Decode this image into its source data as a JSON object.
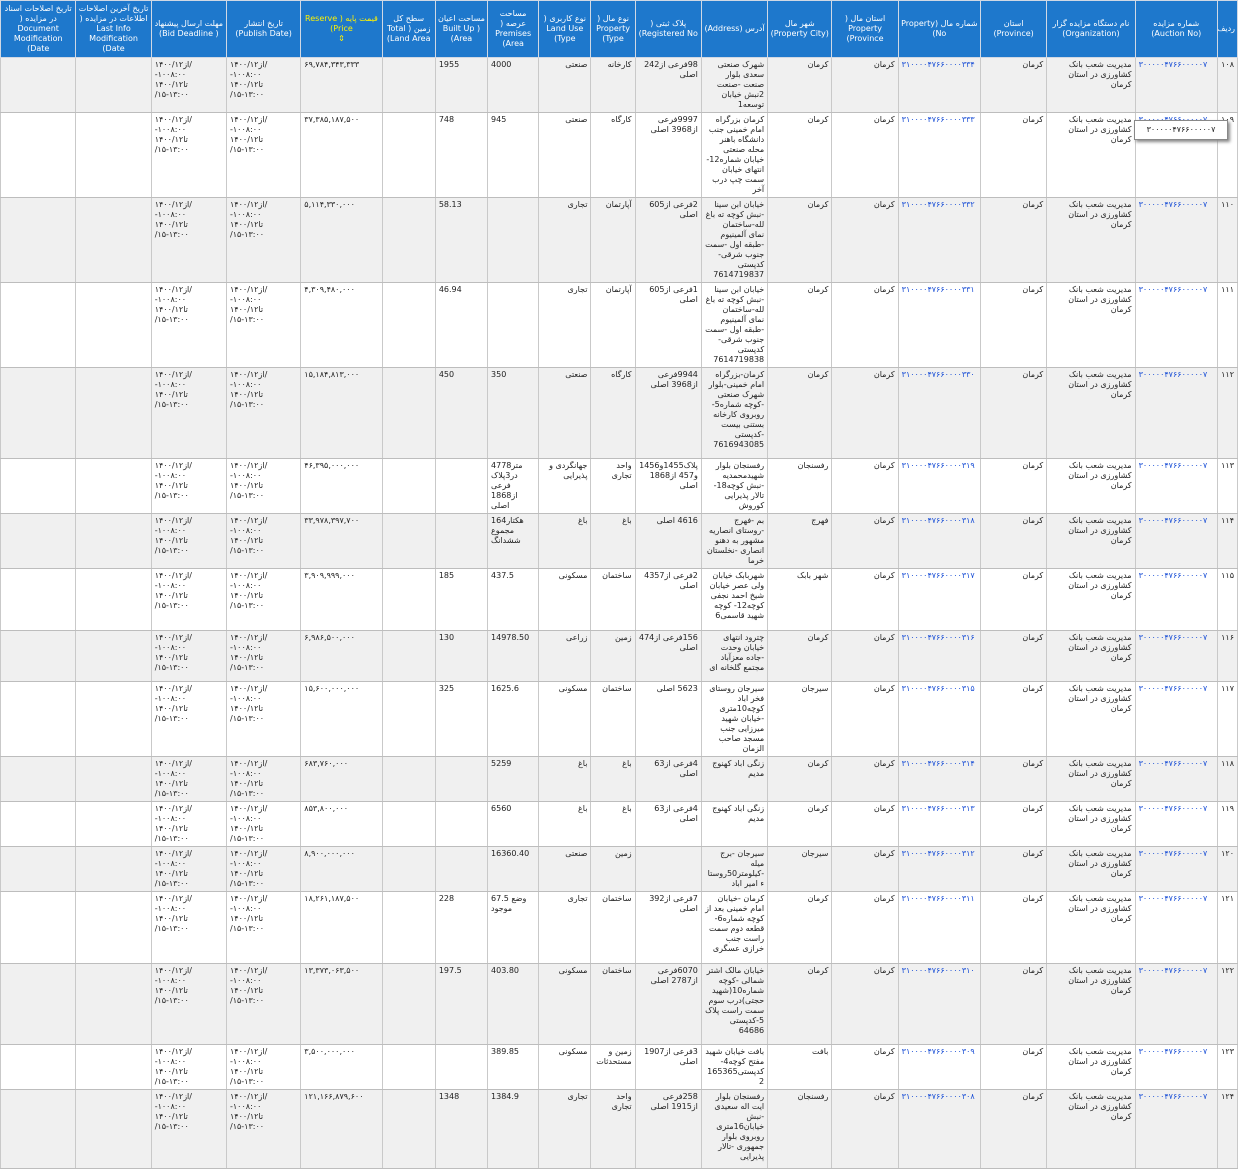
{
  "columns": [
    {
      "key": "row",
      "label": "ردیف",
      "w": 20
    },
    {
      "key": "auction",
      "label": "شماره مزایده (Auction No)",
      "w": 82
    },
    {
      "key": "org",
      "label": "نام دستگاه مزایده گزار (Organization)",
      "w": 88
    },
    {
      "key": "province",
      "label": "استان (Province)",
      "w": 66
    },
    {
      "key": "propno",
      "label": "شماره مال (Property No)",
      "w": 82
    },
    {
      "key": "propprov",
      "label": "استان مال ( Property Province)",
      "w": 66
    },
    {
      "key": "city",
      "label": "شهر مال (Property City)",
      "w": 64
    },
    {
      "key": "address",
      "label": "آدرس (Address)",
      "w": 66
    },
    {
      "key": "reg",
      "label": "پلاک ثبتی ( Registered No)",
      "w": 66
    },
    {
      "key": "type",
      "label": "نوع مال ( Property Type)",
      "w": 44
    },
    {
      "key": "use",
      "label": "نوع کاربری ( Land Use Type)",
      "w": 52
    },
    {
      "key": "area",
      "label": "مساحت عرصه ( Premises Area)",
      "w": 51
    },
    {
      "key": "built",
      "label": "مساحت اعیان ( Built Up Area)",
      "w": 52
    },
    {
      "key": "land",
      "label": "سطح کل زمین ( Total Land Area)",
      "w": 53
    },
    {
      "key": "price",
      "label": "قیمت پایه ( Reserve Price)",
      "w": 81,
      "accent": true
    },
    {
      "key": "publish",
      "label": "تاریخ انتشار (Publish Date)",
      "w": 74
    },
    {
      "key": "deadline",
      "label": "مهلت ارسال پیشنهاد ( Bid Deadline)",
      "w": 75
    },
    {
      "key": "lastmod",
      "label": "تاریخ آخرین اصلاحات اطلاعات در مزایده ( Last Info Modification Date)",
      "w": 75
    },
    {
      "key": "docmod",
      "label": "تاریخ اصلاحات اسناد در مزایده ( Document Modification Date)",
      "w": 75
    }
  ],
  "sort_arrow": "⇕",
  "tooltip_text": "۳۰۰۰۰۰۴۷۶۶۰۰۰۰۰۷",
  "colors": {
    "header_bg": "#1e78cc",
    "header_text": "#ffffff",
    "price_header": "#fff200",
    "link": "#1a4fd6",
    "odd_row": "#f0f0f0"
  },
  "rows": [
    {
      "h": 50,
      "row": "۱۰۸",
      "auction": "۳۰۰۰۰۰۴۷۶۶۰۰۰۰۰۷",
      "org": "مدیریت شعب بانک کشاورزی در استان کرمان",
      "province": "کرمان",
      "propno": "۳۱۰۰۰۰۴۷۶۶۰۰۰۰۳۳۴",
      "propprov": "کرمان",
      "city": "کرمان",
      "address": "شهرک صنعتی سعدی بلوار صنعت -صنعت 2نبش خیابان توسعه1",
      "reg": "98فرعی از242 اصلی",
      "type": "کارخانه",
      "use": "صنعتی",
      "area": "4000",
      "built": "1955",
      "land": "",
      "price": "۶۹,۷۸۴,۳۴۳,۳۳۳",
      "publish": "از۱۴۰۰/۱۲/\n-۱۰۰۸:۰۰\n۱۴۰۰/۱۲تا\n/۱۵-۱۳:۰۰",
      "deadline": "از۱۴۰۰/۱۲/\n-۱۰۰۸:۰۰\n۱۴۰۰/۱۲تا\n/۱۵-۱۳:۰۰",
      "lastmod": "",
      "docmod": ""
    },
    {
      "h": 81,
      "row": "۱۰۹",
      "auction": "۳۰۰۰۰۰۴۷۶۶۰۰۰۰۰۷",
      "org": "مدیریت شعب بانک کشاورزی در استان کرمان",
      "province": "کرمان",
      "propno": "۳۱۰۰۰۰۴۷۶۶۰۰۰۰۳۳۳",
      "propprov": "کرمان",
      "city": "کرمان",
      "address": "کرمان بزرگراه امام خمینی جنب دانشگاه باهنر محله صنعتی خیابان شماره12-انتهای خیابان سمت چپ درب آخر",
      "reg": "9997فرعی از3968 اصلی",
      "type": "کارگاه",
      "use": "صنعتی",
      "area": "945",
      "built": "748",
      "land": "",
      "price": "۳۷,۳۸۵,۱۸۷,۵۰۰",
      "publish": "از۱۴۰۰/۱۲/\n-۱۰۰۸:۰۰\n۱۴۰۰/۱۲تا\n/۱۵-۱۳:۰۰",
      "deadline": "از۱۴۰۰/۱۲/\n-۱۰۰۸:۰۰\n۱۴۰۰/۱۲تا\n/۱۵-۱۳:۰۰",
      "lastmod": "",
      "docmod": ""
    },
    {
      "h": 82,
      "row": "۱۱۰",
      "auction": "۳۰۰۰۰۰۴۷۶۶۰۰۰۰۰۷",
      "org": "مدیریت شعب بانک کشاورزی در استان کرمان",
      "province": "کرمان",
      "propno": "۳۱۰۰۰۰۴۷۶۶۰۰۰۰۳۳۲",
      "propprov": "کرمان",
      "city": "کرمان",
      "address": "خیابان ابن سینا -نبش کوچه ته باغ لله-ساختمان نمای آلمینیوم -طبقه اول -سمت جنوب شرقی-کدپستی 7614719837",
      "reg": "2فرعی از605 اصلی",
      "type": "آپارتمان",
      "use": "تجاری",
      "area": "",
      "built": "58.13",
      "land": "",
      "price": "۵,۱۱۴,۳۳۰,۰۰۰",
      "publish": "از۱۴۰۰/۱۲/\n-۱۰۰۸:۰۰\n۱۴۰۰/۱۲تا\n/۱۵-۱۳:۰۰",
      "deadline": "از۱۴۰۰/۱۲/\n-۱۰۰۸:۰۰\n۱۴۰۰/۱۲تا\n/۱۵-۱۳:۰۰",
      "lastmod": "",
      "docmod": ""
    },
    {
      "h": 81,
      "row": "۱۱۱",
      "auction": "۳۰۰۰۰۰۴۷۶۶۰۰۰۰۰۷",
      "org": "مدیریت شعب بانک کشاورزی در استان کرمان",
      "province": "کرمان",
      "propno": "۳۱۰۰۰۰۴۷۶۶۰۰۰۰۳۳۱",
      "propprov": "کرمان",
      "city": "کرمان",
      "address": "خیابان ابن سینا -نبش کوچه ته باغ لله-ساختمان نمای آلمینیوم -طبقه اول -سمت جنوب شرقی-کدپستی 7614719838",
      "reg": "1فرعی از605 اصلی",
      "type": "آپارتمان",
      "use": "تجاری",
      "area": "",
      "built": "46.94",
      "land": "",
      "price": "۴,۳۰۹,۴۸۰,۰۰۰",
      "publish": "از۱۴۰۰/۱۲/\n-۱۰۰۸:۰۰\n۱۴۰۰/۱۲تا\n/۱۵-۱۳:۰۰",
      "deadline": "از۱۴۰۰/۱۲/\n-۱۰۰۸:۰۰\n۱۴۰۰/۱۲تا\n/۱۵-۱۳:۰۰",
      "lastmod": "",
      "docmod": ""
    },
    {
      "h": 91,
      "row": "۱۱۲",
      "auction": "۳۰۰۰۰۰۴۷۶۶۰۰۰۰۰۷",
      "org": "مدیریت شعب بانک کشاورزی در استان کرمان",
      "province": "کرمان",
      "propno": "۳۱۰۰۰۰۴۷۶۶۰۰۰۰۳۳۰",
      "propprov": "کرمان",
      "city": "کرمان",
      "address": "کرمان-بزرگراه امام خمینی-بلوار شهرک صنعتی -کوچه شماره5-روبروی کارخانه بستنی بیست -کدپستی 7616943085",
      "reg": "9944فرعی از3968 اصلی",
      "type": "کارگاه",
      "use": "صنعتی",
      "area": "350",
      "built": "450",
      "land": "",
      "price": "۱۵,۱۸۴,۸۱۳,۰۰۰",
      "publish": "از۱۴۰۰/۱۲/\n-۱۰۰۸:۰۰\n۱۴۰۰/۱۲تا\n/۱۵-۱۳:۰۰",
      "deadline": "از۱۴۰۰/۱۲/\n-۱۰۰۸:۰۰\n۱۴۰۰/۱۲تا\n/۱۵-۱۳:۰۰",
      "lastmod": "",
      "docmod": ""
    },
    {
      "h": 51,
      "row": "۱۱۳",
      "auction": "۳۰۰۰۰۰۴۷۶۶۰۰۰۰۰۷",
      "org": "مدیریت شعب بانک کشاورزی در استان کرمان",
      "province": "کرمان",
      "propno": "۳۱۰۰۰۰۴۷۶۶۰۰۰۰۳۱۹",
      "propprov": "کرمان",
      "city": "رفسنجان",
      "address": "رفسنجان بلوار شهیدمحمدیه -نبش کوچه18- تالار پذیرایی کوروش",
      "reg": "پلاک1455و1456و457 از1868 اصلی",
      "type": "واحد تجاری",
      "use": "جهانگردی و پذیرایی",
      "area": "4778متر در3پلاک فرعی از1868 اصلی",
      "built": "",
      "land": "",
      "price": "۴۶,۳۹۵,۰۰۰,۰۰۰",
      "publish": "از۱۴۰۰/۱۲/\n-۱۰۰۸:۰۰\n۱۴۰۰/۱۲تا\n/۱۵-۱۳:۰۰",
      "deadline": "از۱۴۰۰/۱۲/\n-۱۰۰۸:۰۰\n۱۴۰۰/۱۲تا\n/۱۵-۱۳:۰۰",
      "lastmod": "",
      "docmod": ""
    },
    {
      "h": 51,
      "row": "۱۱۴",
      "auction": "۳۰۰۰۰۰۴۷۶۶۰۰۰۰۰۷",
      "org": "مدیریت شعب بانک کشاورزی در استان کرمان",
      "province": "کرمان",
      "propno": "۳۱۰۰۰۰۴۷۶۶۰۰۰۰۳۱۸",
      "propprov": "کرمان",
      "city": "فهرج",
      "address": "بم -فهرج -روستای انصاریه مشهور به دهنو انصاری -نخلستان خرما",
      "reg": "4616 اصلی",
      "type": "باغ",
      "use": "باغ",
      "area": "164هکتار مجموع ششدانگ",
      "built": "",
      "land": "",
      "price": "۳۳,۹۷۸,۳۹۷,۷۰۰",
      "publish": "از۱۴۰۰/۱۲/\n-۱۰۰۸:۰۰\n۱۴۰۰/۱۲تا\n/۱۵-۱۳:۰۰",
      "deadline": "از۱۴۰۰/۱۲/\n-۱۰۰۸:۰۰\n۱۴۰۰/۱۲تا\n/۱۵-۱۳:۰۰",
      "lastmod": "",
      "docmod": ""
    },
    {
      "h": 62,
      "row": "۱۱۵",
      "auction": "۳۰۰۰۰۰۴۷۶۶۰۰۰۰۰۷",
      "org": "مدیریت شعب بانک کشاورزی در استان کرمان",
      "province": "کرمان",
      "propno": "۳۱۰۰۰۰۴۷۶۶۰۰۰۰۳۱۷",
      "propprov": "کرمان",
      "city": "شهر بابک",
      "address": "شهربابک خیابان ولی عصر خیابان شیخ احمد نجفی کوچه12- کوچه شهید قاسمی6",
      "reg": "2فرعی از4357 اصلی",
      "type": "ساختمان",
      "use": "مسکونی",
      "area": "437.5",
      "built": "185",
      "land": "",
      "price": "۳,۹۰۹,۹۹۹,۰۰۰",
      "publish": "از۱۴۰۰/۱۲/\n-۱۰۰۸:۰۰\n۱۴۰۰/۱۲تا\n/۱۵-۱۳:۰۰",
      "deadline": "از۱۴۰۰/۱۲/\n-۱۰۰۸:۰۰\n۱۴۰۰/۱۲تا\n/۱۵-۱۳:۰۰",
      "lastmod": "",
      "docmod": ""
    },
    {
      "h": 51,
      "row": "۱۱۶",
      "auction": "۳۰۰۰۰۰۴۷۶۶۰۰۰۰۰۷",
      "org": "مدیریت شعب بانک کشاورزی در استان کرمان",
      "province": "کرمان",
      "propno": "۳۱۰۰۰۰۴۷۶۶۰۰۰۰۳۱۶",
      "propprov": "کرمان",
      "city": "کرمان",
      "address": "چترود انتهای خیابان وحدت -جاده معزآباد مجتمع گلخانه ای",
      "reg": "156فرعی از474 اصلی",
      "type": "زمین",
      "use": "زراعی",
      "area": "14978.50",
      "built": "130",
      "land": "",
      "price": "۶,۹۸۶,۵۰۰,۰۰۰",
      "publish": "از۱۴۰۰/۱۲/\n-۱۰۰۸:۰۰\n۱۴۰۰/۱۲تا\n/۱۵-۱۳:۰۰",
      "deadline": "از۱۴۰۰/۱۲/\n-۱۰۰۸:۰۰\n۱۴۰۰/۱۲تا\n/۱۵-۱۳:۰۰",
      "lastmod": "",
      "docmod": ""
    },
    {
      "h": 72,
      "row": "۱۱۷",
      "auction": "۳۰۰۰۰۰۴۷۶۶۰۰۰۰۰۷",
      "org": "مدیریت شعب بانک کشاورزی در استان کرمان",
      "province": "کرمان",
      "propno": "۳۱۰۰۰۰۴۷۶۶۰۰۰۰۳۱۵",
      "propprov": "کرمان",
      "city": "سیرجان",
      "address": "سیرجان روستای فخر اباد کوچه10متری -خیابان شهید میرزایی جنب مسجد صاحب الزمان",
      "reg": "5623 اصلی",
      "type": "ساختمان",
      "use": "مسکونی",
      "area": "1625.6",
      "built": "325",
      "land": "",
      "price": "۱۵,۶۰۰,۰۰۰,۰۰۰",
      "publish": "از۱۴۰۰/۱۲/\n-۱۰۰۸:۰۰\n۱۴۰۰/۱۲تا\n/۱۵-۱۳:۰۰",
      "deadline": "از۱۴۰۰/۱۲/\n-۱۰۰۸:۰۰\n۱۴۰۰/۱۲تا\n/۱۵-۱۳:۰۰",
      "lastmod": "",
      "docmod": ""
    },
    {
      "h": 41,
      "row": "۱۱۸",
      "auction": "۳۰۰۰۰۰۴۷۶۶۰۰۰۰۰۷",
      "org": "مدیریت شعب بانک کشاورزی در استان کرمان",
      "province": "کرمان",
      "propno": "۳۱۰۰۰۰۴۷۶۶۰۰۰۰۳۱۴",
      "propprov": "کرمان",
      "city": "کرمان",
      "address": "زنگی اباد کهنوج مدیم",
      "reg": "4فرعی از63 اصلی",
      "type": "باغ",
      "use": "باغ",
      "area": "5259",
      "built": "",
      "land": "",
      "price": "۶۸۳,۷۶۰,۰۰۰",
      "publish": "از۱۴۰۰/۱۲/\n-۱۰۰۸:۰۰\n۱۴۰۰/۱۲تا\n/۱۵-۱۳:۰۰",
      "deadline": "از۱۴۰۰/۱۲/\n-۱۰۰۸:۰۰\n۱۴۰۰/۱۲تا\n/۱۵-۱۳:۰۰",
      "lastmod": "",
      "docmod": ""
    },
    {
      "h": 41,
      "row": "۱۱۹",
      "auction": "۳۰۰۰۰۰۴۷۶۶۰۰۰۰۰۷",
      "org": "مدیریت شعب بانک کشاورزی در استان کرمان",
      "province": "کرمان",
      "propno": "۳۱۰۰۰۰۴۷۶۶۰۰۰۰۳۱۳",
      "propprov": "کرمان",
      "city": "کرمان",
      "address": "زنگی اباد کهنوج مدیم",
      "reg": "4فرعی از63 اصلی",
      "type": "باغ",
      "use": "باغ",
      "area": "6560",
      "built": "",
      "land": "",
      "price": "۸۵۳,۸۰۰,۰۰۰",
      "publish": "از۱۴۰۰/۱۲/\n-۱۰۰۸:۰۰\n۱۴۰۰/۱۲تا\n/۱۵-۱۳:۰۰",
      "deadline": "از۱۴۰۰/۱۲/\n-۱۰۰۸:۰۰\n۱۴۰۰/۱۲تا\n/۱۵-۱۳:۰۰",
      "lastmod": "",
      "docmod": ""
    },
    {
      "h": 41,
      "row": "۱۲۰",
      "auction": "۳۰۰۰۰۰۴۷۶۶۰۰۰۰۰۷",
      "org": "مدیریت شعب بانک کشاورزی در استان کرمان",
      "province": "کرمان",
      "propno": "۳۱۰۰۰۰۴۷۶۶۰۰۰۰۳۱۲",
      "propprov": "کرمان",
      "city": "سیرجان",
      "address": "سیرجان -برج میله -کیلومتر50روستاء امیر اباد",
      "reg": "",
      "type": "زمین",
      "use": "صنعتی",
      "area": "16360.40",
      "built": "",
      "land": "",
      "price": "۸,۹۰۰,۰۰۰,۰۰۰",
      "publish": "از۱۴۰۰/۱۲/\n-۱۰۰۸:۰۰\n۱۴۰۰/۱۲تا\n/۱۵-۱۳:۰۰",
      "deadline": "از۱۴۰۰/۱۲/\n-۱۰۰۸:۰۰\n۱۴۰۰/۱۲تا\n/۱۵-۱۳:۰۰",
      "lastmod": "",
      "docmod": ""
    },
    {
      "h": 72,
      "row": "۱۲۱",
      "auction": "۳۰۰۰۰۰۴۷۶۶۰۰۰۰۰۷",
      "org": "مدیریت شعب بانک کشاورزی در استان کرمان",
      "province": "کرمان",
      "propno": "۳۱۰۰۰۰۴۷۶۶۰۰۰۰۳۱۱",
      "propprov": "کرمان",
      "city": "کرمان",
      "address": "کرمان -خیابان امام خمینی بعد از کوچه شماره6-قطعه دوم سمت راست جنب خرازی عسگری",
      "reg": "7فرعی از392 اصلی",
      "type": "ساختمان",
      "use": "تجاری",
      "area": "67.5 وضع موجود",
      "built": "228",
      "land": "",
      "price": "۱۸,۲۶۱,۱۸۷,۵۰۰",
      "publish": "از۱۴۰۰/۱۲/\n-۱۰۰۸:۰۰\n۱۴۰۰/۱۲تا\n/۱۵-۱۳:۰۰",
      "deadline": "از۱۴۰۰/۱۲/\n-۱۰۰۸:۰۰\n۱۴۰۰/۱۲تا\n/۱۵-۱۳:۰۰",
      "lastmod": "",
      "docmod": ""
    },
    {
      "h": 81,
      "row": "۱۲۲",
      "auction": "۳۰۰۰۰۰۴۷۶۶۰۰۰۰۰۷",
      "org": "مدیریت شعب بانک کشاورزی در استان کرمان",
      "province": "کرمان",
      "propno": "۳۱۰۰۰۰۴۷۶۶۰۰۰۰۳۱۰",
      "propprov": "کرمان",
      "city": "کرمان",
      "address": "خیابان مالک اشتر شمالی -کوچه شماره10(شهید حجتی)درب سوم سمت راست پلاک 5-کدپستی 64686",
      "reg": "6070فرعی از2787 اصلی",
      "type": "ساختمان",
      "use": "مسکونی",
      "area": "403.80",
      "built": "197.5",
      "land": "",
      "price": "۱۳,۳۷۳,۰۶۳,۵۰۰",
      "publish": "از۱۴۰۰/۱۲/\n-۱۰۰۸:۰۰\n۱۴۰۰/۱۲تا\n/۱۵-۱۳:۰۰",
      "deadline": "از۱۴۰۰/۱۲/\n-۱۰۰۸:۰۰\n۱۴۰۰/۱۲تا\n/۱۵-۱۳:۰۰",
      "lastmod": "",
      "docmod": ""
    },
    {
      "h": 41,
      "row": "۱۲۳",
      "auction": "۳۰۰۰۰۰۴۷۶۶۰۰۰۰۰۷",
      "org": "مدیریت شعب بانک کشاورزی در استان کرمان",
      "province": "کرمان",
      "propno": "۳۱۰۰۰۰۴۷۶۶۰۰۰۰۳۰۹",
      "propprov": "کرمان",
      "city": "بافت",
      "address": "بافت خیابان شهید مفتح کوچه4- کدپستی1653652",
      "reg": "3فرعی از1907 اصلی",
      "type": "زمین و مستحدثات",
      "use": "مسکونی",
      "area": "389.85",
      "built": "",
      "land": "",
      "price": "۳,۵۰۰,۰۰۰,۰۰۰",
      "publish": "از۱۴۰۰/۱۲/\n-۱۰۰۸:۰۰\n۱۴۰۰/۱۲تا\n/۱۵-۱۳:۰۰",
      "deadline": "از۱۴۰۰/۱۲/\n-۱۰۰۸:۰۰\n۱۴۰۰/۱۲تا\n/۱۵-۱۳:۰۰",
      "lastmod": "",
      "docmod": ""
    },
    {
      "h": 79,
      "row": "۱۲۴",
      "auction": "۳۰۰۰۰۰۴۷۶۶۰۰۰۰۰۷",
      "org": "مدیریت شعب بانک کشاورزی در استان کرمان",
      "province": "کرمان",
      "propno": "۳۱۰۰۰۰۴۷۶۶۰۰۰۰۳۰۸",
      "propprov": "کرمان",
      "city": "رفسنجان",
      "address": "رفسنجان بلوار ایت اله سعیدی -نبش خیابان16متری روبروی بلوار جمهوری -تالار پذیرایی",
      "reg": "258فرعی از1915 اصلی",
      "type": "واحد تجاری",
      "use": "تجاری",
      "area": "1384.9",
      "built": "1348",
      "land": "",
      "price": "۱۲۱,۱۶۶,۸۷۹,۶۰۰",
      "publish": "از۱۴۰۰/۱۲/\n-۱۰۰۸:۰۰\n۱۴۰۰/۱۲تا\n/۱۵-۱۳:۰۰",
      "deadline": "از۱۴۰۰/۱۲/\n-۱۰۰۸:۰۰\n۱۴۰۰/۱۲تا\n/۱۵-۱۳:۰۰",
      "lastmod": "",
      "docmod": ""
    }
  ]
}
